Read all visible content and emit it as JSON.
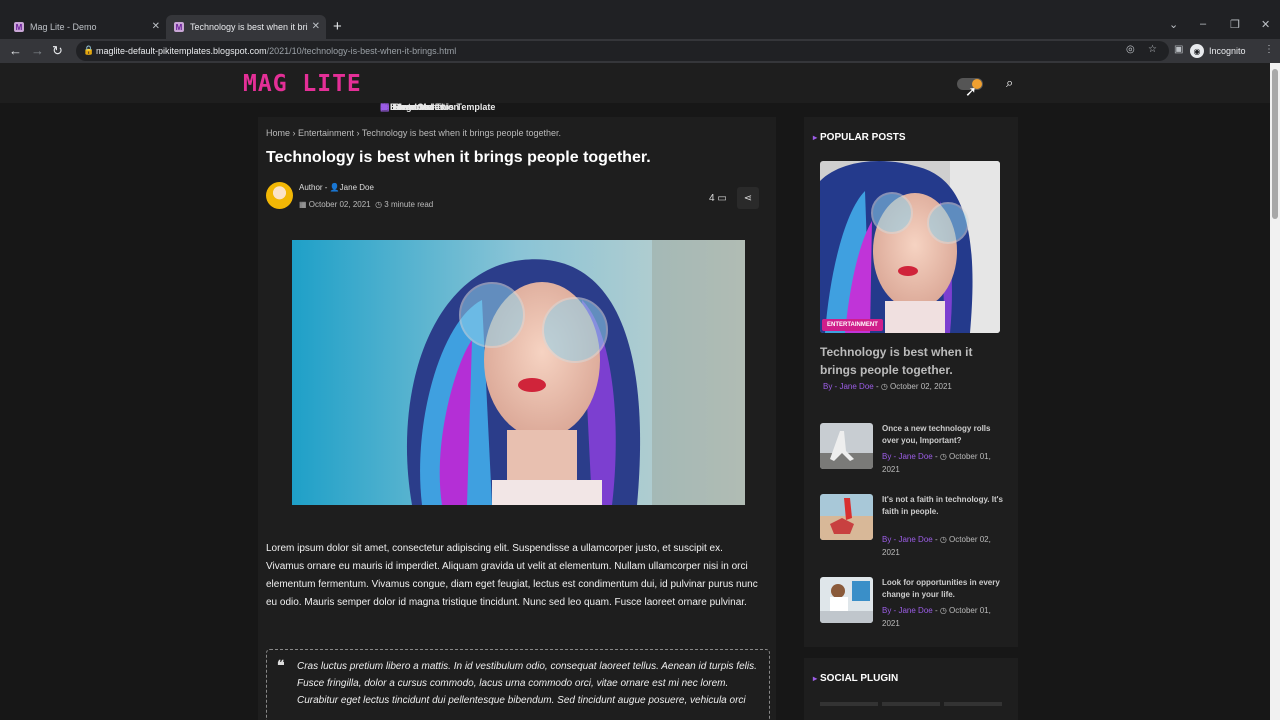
{
  "browser": {
    "tabs": [
      {
        "title": "Mag Lite - Demo",
        "active": false
      },
      {
        "title": "Technology is best when it brings people together.",
        "active": true
      }
    ],
    "url_domain": "maglite-default-pikitemplates.blogspot.com",
    "url_path": "/2021/10/technology-is-best-when-it-brings.html",
    "profile_label": "Incognito"
  },
  "header": {
    "logo": "MAG LITE",
    "menu": [
      {
        "label": "Home",
        "icon": "home-icon",
        "dropdown": false
      },
      {
        "label": "Mega Menu",
        "icon": "folder-icon",
        "dropdown": true
      },
      {
        "label": "Features",
        "icon": "layers-icon",
        "dropdown": true
      },
      {
        "label": "Documentation",
        "icon": "folder-icon",
        "dropdown": false
      },
      {
        "label": "ShortCodes",
        "icon": "code-icon",
        "dropdown": false
      },
      {
        "label": "Download This Template",
        "icon": "branch-icon",
        "dropdown": false
      }
    ]
  },
  "post": {
    "breadcrumb": [
      "Home",
      "Entertainment",
      "Technology is best when it brings people together."
    ],
    "title": "Technology is best when it brings people together.",
    "author_prefix": "Author -",
    "author": "Jane Doe",
    "date": "October 02, 2021",
    "read_time": "3 minute read",
    "comments": "4",
    "body": "Lorem ipsum dolor sit amet, consectetur adipiscing elit. Suspendisse a ullamcorper justo, et suscipit ex. Vivamus ornare eu mauris id imperdiet. Aliquam gravida ut velit at elementum. Nullam ullamcorper nisi in orci elementum fermentum. Vivamus congue, diam eget feugiat, lectus est condimentum dui, id pulvinar purus nunc eu odio. Mauris semper dolor id magna tristique tincidunt. Nunc sed leo quam. Fusce laoreet ornare pulvinar.",
    "quote": "Cras luctus pretium libero a mattis. In id vestibulum odio, consequat laoreet tellus. Aenean id turpis felis. Fusce fringilla, dolor a cursus commodo, lacus urna commodo orci, vitae ornare est mi nec lorem. Curabitur eget lectus tincidunt dui pellentesque bibendum. Sed tincidunt augue posuere, vehicula orci"
  },
  "sidebar": {
    "popular_title": "POPULAR POSTS",
    "featured": {
      "badge": "ENTERTAINMENT",
      "title": "Technology is best when it brings people together.",
      "by": "By -",
      "author": "Jane Doe",
      "date": "October 02, 2021"
    },
    "items": [
      {
        "title": "Once a new technology rolls over you, Important?",
        "by": "By -",
        "author": "Jane Doe",
        "date": "October 01, 2021"
      },
      {
        "title": "It's not a faith in technology. It's faith in people.",
        "by": "By -",
        "author": "Jane Doe",
        "date": "October 02, 2021"
      },
      {
        "title": "Look for opportunities in every change in your life.",
        "by": "By -",
        "author": "Jane Doe",
        "date": "October 01, 2021"
      }
    ],
    "social_title": "SOCIAL PLUGIN"
  },
  "colors": {
    "accent": "#9b5de5",
    "badge": "#d01e8b",
    "logo": "#e42f97"
  }
}
